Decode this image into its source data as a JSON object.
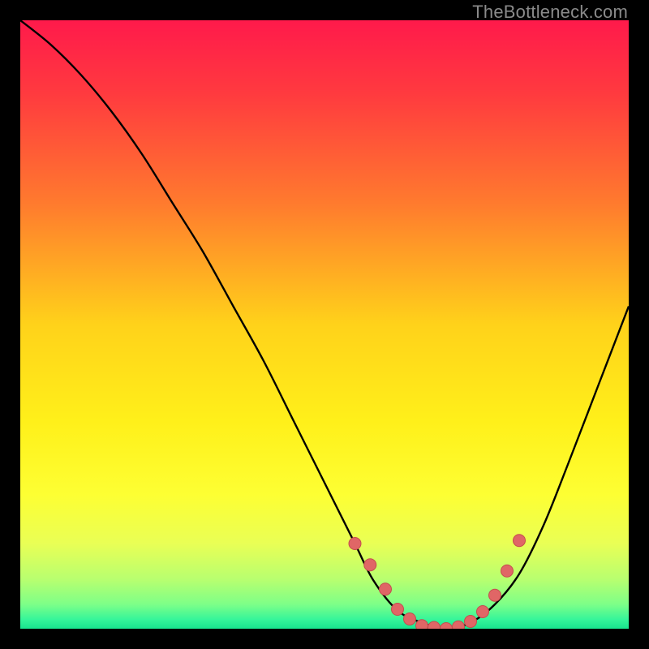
{
  "watermark": "TheBottleneck.com",
  "colors": {
    "black": "#000000",
    "curve": "#000000",
    "marker_fill": "#e06666",
    "marker_stroke": "#c44d4d"
  },
  "chart_data": {
    "type": "line",
    "title": "",
    "xlabel": "",
    "ylabel": "",
    "xlim": [
      0,
      100
    ],
    "ylim": [
      0,
      100
    ],
    "gradient_stops": [
      {
        "offset": 0.0,
        "color": "#ff1a4b"
      },
      {
        "offset": 0.12,
        "color": "#ff3a3f"
      },
      {
        "offset": 0.3,
        "color": "#ff7a2e"
      },
      {
        "offset": 0.5,
        "color": "#ffd21a"
      },
      {
        "offset": 0.66,
        "color": "#fff01a"
      },
      {
        "offset": 0.78,
        "color": "#fdff33"
      },
      {
        "offset": 0.86,
        "color": "#e9ff55"
      },
      {
        "offset": 0.92,
        "color": "#b7ff70"
      },
      {
        "offset": 0.96,
        "color": "#7dff88"
      },
      {
        "offset": 0.985,
        "color": "#35f59a"
      },
      {
        "offset": 1.0,
        "color": "#18e48f"
      }
    ],
    "series": [
      {
        "name": "bottleneck-curve",
        "x": [
          0,
          5,
          10,
          15,
          20,
          25,
          30,
          35,
          40,
          45,
          50,
          55,
          58,
          62,
          66,
          70,
          74,
          78,
          82,
          86,
          90,
          95,
          100
        ],
        "y": [
          100,
          96,
          91,
          85,
          78,
          70,
          62,
          53,
          44,
          34,
          24,
          14,
          8,
          3,
          1,
          0,
          1,
          4,
          9,
          17,
          27,
          40,
          53
        ]
      }
    ],
    "markers": {
      "name": "highlighted-points",
      "x": [
        55,
        57.5,
        60,
        62,
        64,
        66,
        68,
        70,
        72,
        74,
        76,
        78,
        80,
        82
      ],
      "y": [
        14,
        10.5,
        6.5,
        3.2,
        1.6,
        0.5,
        0.2,
        0,
        0.3,
        1.2,
        2.8,
        5.5,
        9.5,
        14.5
      ]
    }
  }
}
